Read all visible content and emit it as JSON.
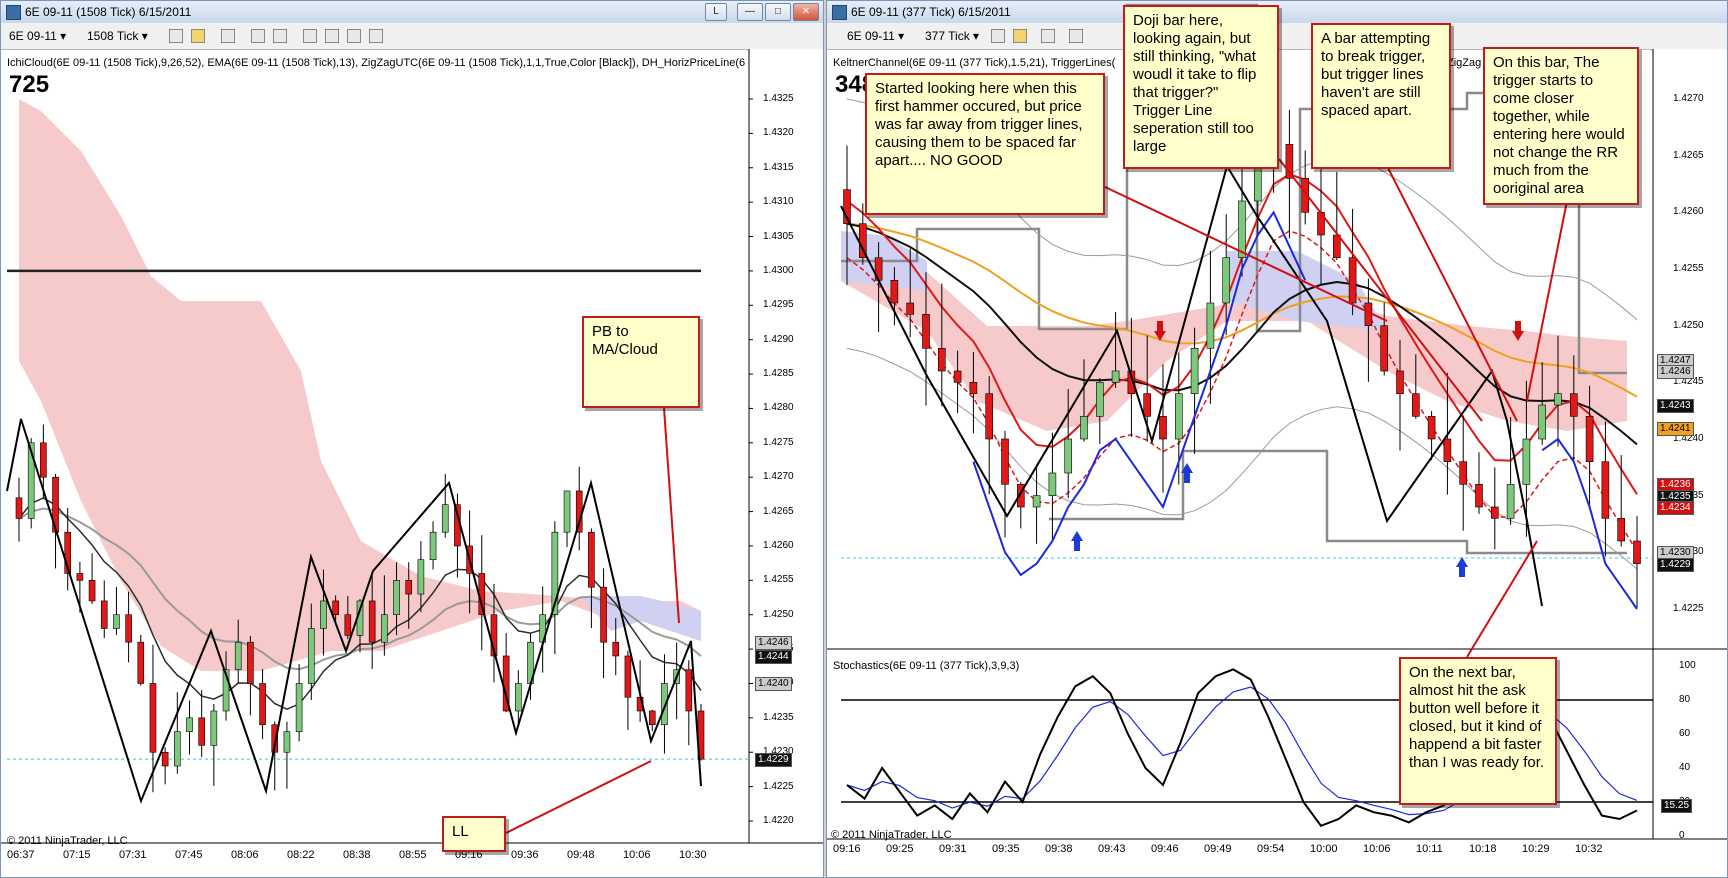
{
  "left_window": {
    "title": "6E 09-11 (1508 Tick)  6/15/2011",
    "l_button": "L",
    "toolbar": {
      "instrument": "6E 09-11",
      "period": "1508 Tick"
    },
    "indicators_line": "IchiCloud(6E 09-11 (1508 Tick),9,26,52), EMA(6E 09-11 (1508 Tick),13), ZigZagUTC(6E 09-11 (1508 Tick),1,1,True,Color [Black]), DH_HorizPriceLine(6",
    "big_number": "725",
    "copyright": "© 2011 NinjaTrader, LLC",
    "price_axis": [
      "1.4325",
      "1.4320",
      "1.4315",
      "1.4310",
      "1.4305",
      "1.4300",
      "1.4295",
      "1.4290",
      "1.4285",
      "1.4280",
      "1.4275",
      "1.4270",
      "1.4265",
      "1.4260",
      "1.4255",
      "1.4250",
      "1.4245",
      "1.4240",
      "1.4235",
      "1.4230",
      "1.4225",
      "1.4220"
    ],
    "price_labels": [
      "1.4246",
      "1.4244",
      "1.4240",
      "1.4229"
    ],
    "time_axis": [
      "06:37",
      "07:15",
      "07:31",
      "07:45",
      "08:06",
      "08:22",
      "08:38",
      "08:55",
      "09:16",
      "09:36",
      "09:48",
      "10:06",
      "10:30"
    ],
    "notes": {
      "pb": "PB to MA/Cloud",
      "ll": "LL"
    }
  },
  "right_window": {
    "title": "6E 09-11 (377 Tick)  6/15/2011",
    "toolbar": {
      "instrument": "6E 09-11",
      "period": "377 Tick"
    },
    "indicators_line": "KeltnerChannel(6E 09-11 (377 Tick),1.5,21), TriggerLines(",
    "indicators_line_tail": "ZigZag",
    "big_number": "348",
    "copyright": "© 2011 NinjaTrader, LLC",
    "price_axis": [
      "1.4270",
      "1.4265",
      "1.4260",
      "1.4255",
      "1.4250",
      "1.4245",
      "1.4240",
      "1.4235",
      "1.4230",
      "1.4225"
    ],
    "price_labels": [
      "1.4247",
      "1.4246",
      "1.4243",
      "1.4241",
      "1.4236",
      "1.4235",
      "1.4234",
      "1.4230",
      "1.4229"
    ],
    "stoch_title": "Stochastics(6E 09-11 (377 Tick),3,9,3)",
    "stoch_axis": [
      "100",
      "80",
      "60",
      "40",
      "20",
      "0"
    ],
    "stoch_value": "15.25",
    "time_axis": [
      "09:16",
      "09:25",
      "09:31",
      "09:35",
      "09:38",
      "09:43",
      "09:46",
      "09:49",
      "09:54",
      "10:00",
      "10:06",
      "10:11",
      "10:18",
      "10:29",
      "10:32"
    ],
    "notes": {
      "started": "Started looking here when this first hammer occured, but price was far away from trigger lines, causing them to be spaced far apart.... NO GOOD",
      "doji": "Doji bar here, looking again, but still thinking, \"what woudl it take to flip that trigger?\" Trigger Line seperation still too large",
      "attempt": "A bar attempting to break trigger, but trigger lines haven't are still spaced apart.",
      "closer": "On this bar, The trigger starts to come closer together, while entering here would not change the RR much from the ooriginal area",
      "next": "On the next bar, almost hit the ask button well before it closed, but it kind of happend a bit faster than I was ready for."
    }
  },
  "colors": {
    "up": "#7cc97c",
    "down": "#e01818",
    "cloud": "#f6caca",
    "cloud_blue": "#cfd0f2",
    "note_bg": "#ffffcc",
    "note_border": "#c41a1a"
  }
}
